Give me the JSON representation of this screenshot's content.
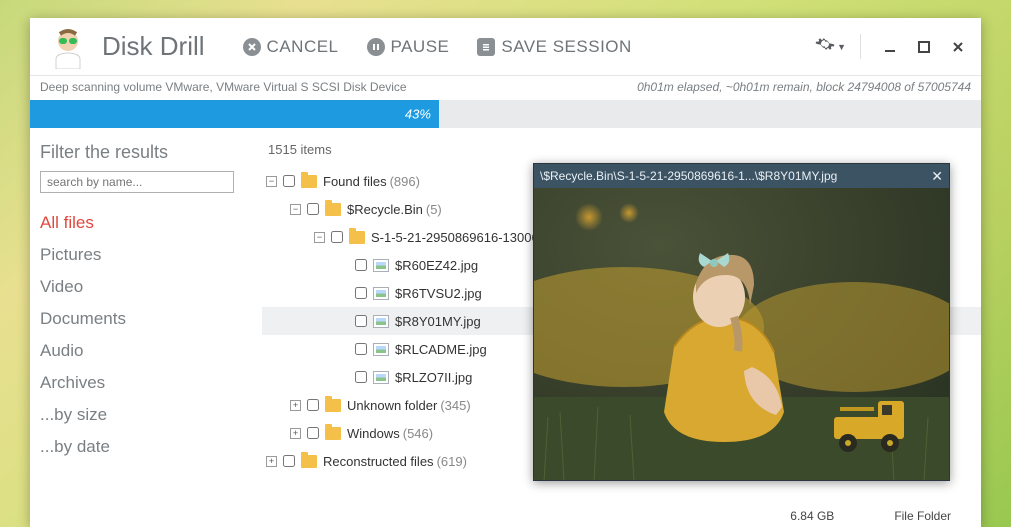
{
  "app": {
    "title": "Disk Drill"
  },
  "toolbar": {
    "cancel": "CANCEL",
    "pause": "PAUSE",
    "save_session": "SAVE SESSION"
  },
  "status": {
    "left": "Deep scanning volume VMware, VMware Virtual S SCSI Disk Device",
    "right": "0h01m elapsed, ~0h01m remain, block 24794008 of 57005744"
  },
  "progress": {
    "percent_label": "43%",
    "percent_value": 43
  },
  "sidebar": {
    "title": "Filter the results",
    "search_placeholder": "search by name...",
    "filters": [
      "All files",
      "Pictures",
      "Video",
      "Documents",
      "Audio",
      "Archives",
      "...by size",
      "...by date"
    ],
    "active_index": 0
  },
  "items_count": "1515 items",
  "tree": {
    "found_label": "Found files",
    "found_count": "(896)",
    "recycle_label": "$Recycle.Bin",
    "recycle_count": "(5)",
    "sid_label": "S-1-5-21-2950869616-13006",
    "files": [
      "$R60EZ42.jpg",
      "$R6TVSU2.jpg",
      "$R8Y01MY.jpg",
      "$RLCADME.jpg",
      "$RLZO7II.jpg"
    ],
    "selected_file_index": 2,
    "unknown_label": "Unknown folder",
    "unknown_count": "(345)",
    "windows_label": "Windows",
    "windows_count": "(546)",
    "reconstructed_label": "Reconstructed files",
    "reconstructed_count": "(619)"
  },
  "preview": {
    "path": "\\$Recycle.Bin\\S-1-5-21-2950869616-1...\\$R8Y01MY.jpg"
  },
  "statusbar": {
    "size": "6.84 GB",
    "type": "File Folder"
  }
}
